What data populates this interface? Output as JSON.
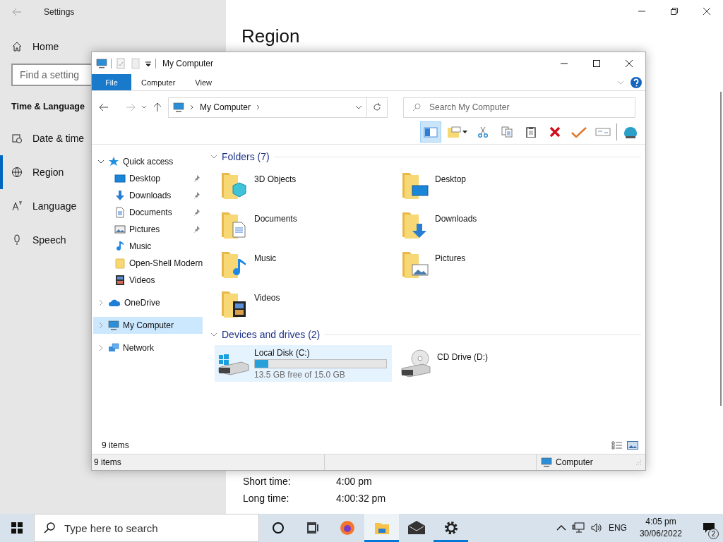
{
  "settings": {
    "title": "Settings",
    "home": "Home",
    "search": {
      "placeholder": "Find a setting"
    },
    "section": "Time & Language",
    "items": [
      {
        "label": "Date & time",
        "kind": "calendar",
        "selected": false
      },
      {
        "label": "Region",
        "kind": "globe",
        "selected": true
      },
      {
        "label": "Language",
        "kind": "language",
        "selected": false
      },
      {
        "label": "Speech",
        "kind": "microphone",
        "selected": false
      }
    ],
    "heading": "Region",
    "rows": [
      {
        "label": "Short time:",
        "value": "4:00 pm"
      },
      {
        "label": "Long time:",
        "value": "4:00:32 pm"
      }
    ]
  },
  "explorer": {
    "title": "My Computer",
    "ribbon_tabs": [
      {
        "label": "File",
        "kind": "menu"
      },
      {
        "label": "Computer",
        "kind": "tab"
      },
      {
        "label": "View",
        "kind": "tab"
      }
    ],
    "address": "My Computer",
    "search": {
      "placeholder": "Search My Computer"
    },
    "toolbar": [
      {
        "kind": "preview-pane",
        "selected": true
      },
      {
        "kind": "new-item",
        "selected": false
      },
      {
        "kind": "cut",
        "selected": false
      },
      {
        "kind": "copy",
        "selected": false
      },
      {
        "kind": "paste",
        "selected": false
      },
      {
        "kind": "delete",
        "selected": false
      },
      {
        "kind": "check",
        "selected": false
      },
      {
        "kind": "properties",
        "selected": false
      },
      {
        "kind": "shell",
        "selected": false
      }
    ],
    "nav_tree": [
      {
        "label": "Quick access",
        "kind": "star",
        "expanded": true,
        "selected": false,
        "children": [
          {
            "label": "Desktop",
            "kind": "desktop",
            "pinned": true,
            "selected": false
          },
          {
            "label": "Downloads",
            "kind": "downloads",
            "pinned": true,
            "selected": false
          },
          {
            "label": "Documents",
            "kind": "documents",
            "pinned": true,
            "selected": false
          },
          {
            "label": "Pictures",
            "kind": "pictures",
            "pinned": true,
            "selected": false
          },
          {
            "label": "Music",
            "kind": "music",
            "pinned": false,
            "selected": false
          },
          {
            "label": "Open-Shell Modern",
            "kind": "folder",
            "pinned": false,
            "selected": false
          },
          {
            "label": "Videos",
            "kind": "videos",
            "pinned": false,
            "selected": false
          }
        ]
      },
      {
        "label": "OneDrive",
        "kind": "cloud",
        "expanded": false,
        "selected": false
      },
      {
        "label": "My Computer",
        "kind": "computer",
        "expanded": false,
        "selected": true
      },
      {
        "label": "Network",
        "kind": "network",
        "expanded": false,
        "selected": false
      }
    ],
    "folders_header": "Folders (7)",
    "folders": [
      {
        "name": "3D Objects",
        "kind": "objects"
      },
      {
        "name": "Desktop",
        "kind": "desktop"
      },
      {
        "name": "Documents",
        "kind": "documents"
      },
      {
        "name": "Downloads",
        "kind": "downloads"
      },
      {
        "name": "Music",
        "kind": "music"
      },
      {
        "name": "Pictures",
        "kind": "pictures"
      },
      {
        "name": "Videos",
        "kind": "videos"
      }
    ],
    "drives_header": "Devices and drives (2)",
    "drives": [
      {
        "name": "Local Disk (C:)",
        "kind": "hdd",
        "free": "13.5 GB free of 15.0 GB",
        "level": 0.1,
        "selected": true
      },
      {
        "name": "CD Drive (D:)",
        "kind": "cd",
        "selected": false
      }
    ],
    "item_count": "9 items",
    "status": {
      "count": "9 items",
      "location": "Computer"
    }
  },
  "taskbar": {
    "search": {
      "placeholder": "Type here to search"
    },
    "apps": [
      {
        "kind": "cortana",
        "running": false,
        "selected": false
      },
      {
        "kind": "task-view",
        "running": false,
        "selected": false
      },
      {
        "kind": "firefox",
        "running": false,
        "selected": false
      },
      {
        "kind": "explorer",
        "running": true,
        "selected": true
      },
      {
        "kind": "mail",
        "running": false,
        "selected": false
      },
      {
        "kind": "settings",
        "running": true,
        "selected": false
      }
    ],
    "language": "ENG",
    "time": "4:05 pm",
    "date": "30/06/2022",
    "notifications": "2"
  }
}
